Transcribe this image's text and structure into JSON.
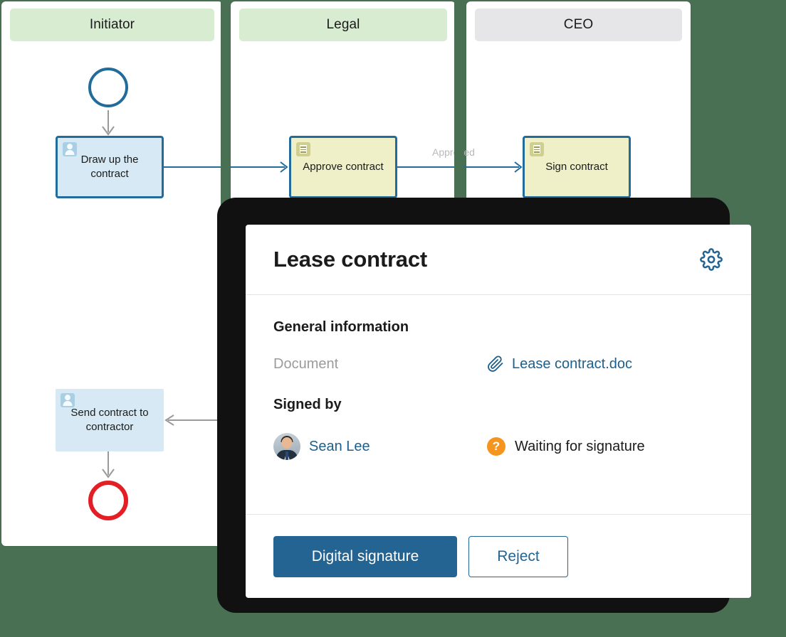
{
  "page": {
    "background_color": "#4a7054"
  },
  "diagram": {
    "type": "bpmn-swimlane",
    "lanes": [
      {
        "title": "Initiator",
        "header_color": "#d7ecd0"
      },
      {
        "title": "Legal",
        "header_color": "#d7ecd0"
      },
      {
        "title": "CEO",
        "header_color": "#e6e6e8"
      }
    ],
    "nodes": [
      {
        "id": "start",
        "kind": "start-event",
        "lane": "Initiator",
        "label": "",
        "color": "#216c9b"
      },
      {
        "id": "draw",
        "kind": "user-task",
        "lane": "Initiator",
        "label": "Draw up the contract",
        "icon": "user-icon",
        "fill": "#d6e9f4",
        "border": "#216c9b"
      },
      {
        "id": "approve",
        "kind": "document-task",
        "lane": "Legal",
        "label": "Approve contract",
        "icon": "document-icon",
        "fill": "#eff0c8",
        "border": "#216c9b"
      },
      {
        "id": "sign",
        "kind": "document-task",
        "lane": "CEO",
        "label": "Sign contract",
        "icon": "document-icon",
        "fill": "#eff0c8",
        "border": "#216c9b"
      },
      {
        "id": "send",
        "kind": "user-task",
        "lane": "Initiator",
        "label": "Send contract to contractor",
        "icon": "user-icon",
        "fill": "#d6e9f4",
        "border": "none"
      },
      {
        "id": "end",
        "kind": "end-event",
        "lane": "Initiator",
        "label": "",
        "color": "#e31e24"
      }
    ],
    "flows": [
      {
        "from": "start",
        "to": "draw",
        "label": ""
      },
      {
        "from": "draw",
        "to": "approve",
        "label": ""
      },
      {
        "from": "approve",
        "to": "sign",
        "label": "Approved"
      },
      {
        "from": "sign",
        "to": "send",
        "label": ""
      },
      {
        "from": "send",
        "to": "end",
        "label": ""
      }
    ]
  },
  "modal": {
    "title": "Lease contract",
    "settings_icon": "gear-icon",
    "sections": [
      {
        "heading": "General information",
        "rows": [
          {
            "label": "Document",
            "value": "Lease contract.doc",
            "icon": "paperclip-icon",
            "is_link": true
          }
        ]
      },
      {
        "heading": "Signed by",
        "rows": [
          {
            "label": "Sean Lee",
            "value": "Waiting for signature",
            "icon": "avatar",
            "status_icon": "question-badge",
            "status_color": "#f5951e"
          }
        ]
      }
    ],
    "buttons": {
      "primary": "Digital signature",
      "secondary": "Reject"
    },
    "accent_color": "#236492"
  }
}
